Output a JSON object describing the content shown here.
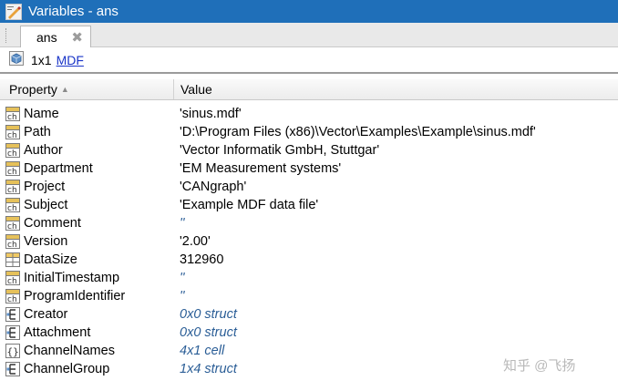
{
  "window": {
    "title": "Variables - ans",
    "title_icon": "variable-editor-icon"
  },
  "tabs": [
    {
      "label": "ans",
      "close_icon": "close-icon"
    }
  ],
  "info": {
    "size": "1x1",
    "class_link": "MDF",
    "icon": "struct-cube-icon"
  },
  "table": {
    "headers": {
      "property": "Property",
      "value": "Value"
    },
    "rows": [
      {
        "name": "Name",
        "value": "'sinus.mdf'",
        "icon": "char-icon",
        "kind": "char"
      },
      {
        "name": "Path",
        "value": "'D:\\Program Files (x86)\\Vector\\Examples\\Example\\sinus.mdf'",
        "icon": "char-icon",
        "kind": "char"
      },
      {
        "name": "Author",
        "value": "'Vector Informatik GmbH, Stuttgar'",
        "icon": "char-icon",
        "kind": "char"
      },
      {
        "name": "Department",
        "value": "'EM   Measurement systems'",
        "icon": "char-icon",
        "kind": "char"
      },
      {
        "name": "Project",
        "value": "'CANgraph'",
        "icon": "char-icon",
        "kind": "char"
      },
      {
        "name": "Subject",
        "value": "'Example MDF data file'",
        "icon": "char-icon",
        "kind": "char"
      },
      {
        "name": "Comment",
        "value": "''",
        "icon": "char-icon",
        "kind": "empty"
      },
      {
        "name": "Version",
        "value": "'2.00'",
        "icon": "char-icon",
        "kind": "char"
      },
      {
        "name": "DataSize",
        "value": "312960",
        "icon": "numeric-grid-icon",
        "kind": "num"
      },
      {
        "name": "InitialTimestamp",
        "value": "''",
        "icon": "char-icon",
        "kind": "empty"
      },
      {
        "name": "ProgramIdentifier",
        "value": "''",
        "icon": "char-icon",
        "kind": "empty"
      },
      {
        "name": "Creator",
        "value": "0x0 struct",
        "icon": "struct-icon",
        "kind": "struct"
      },
      {
        "name": "Attachment",
        "value": "0x0 struct",
        "icon": "struct-icon",
        "kind": "struct"
      },
      {
        "name": "ChannelNames",
        "value": "4x1 cell",
        "icon": "cell-icon",
        "kind": "cell"
      },
      {
        "name": "ChannelGroup",
        "value": "1x4 struct",
        "icon": "struct-icon",
        "kind": "struct"
      }
    ]
  },
  "watermark": "知乎 @飞扬",
  "colors": {
    "titlebar": "#1f6fb9",
    "link": "#1a35c8",
    "dim_value": "#2a5d96"
  }
}
